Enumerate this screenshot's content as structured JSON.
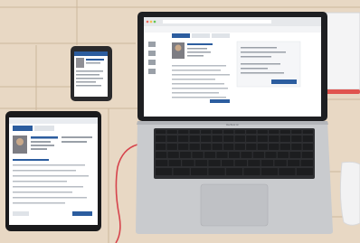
{
  "scene": {
    "description_free": true,
    "colors": {
      "wood": "#e8d8c4",
      "wood_line": "#cdb79c",
      "laptop_body": "#c9cbce",
      "keyboard_bg": "#2d2e31",
      "key": "#1c1d1f",
      "screen_frame": "#1e1f22",
      "app_header": "#ffffff",
      "app_accent": "#2c5d9f",
      "tablet_frame": "#1a1a1c",
      "phone_frame": "#2a2a2c",
      "cable": "#d6434c",
      "pencil": "#e0544e"
    }
  },
  "laptop": {
    "tabs": [
      "",
      "",
      "",
      ""
    ],
    "brand": "MacBook Air"
  },
  "tablet": {
    "button_primary": "",
    "button_secondary": ""
  },
  "phone": {}
}
